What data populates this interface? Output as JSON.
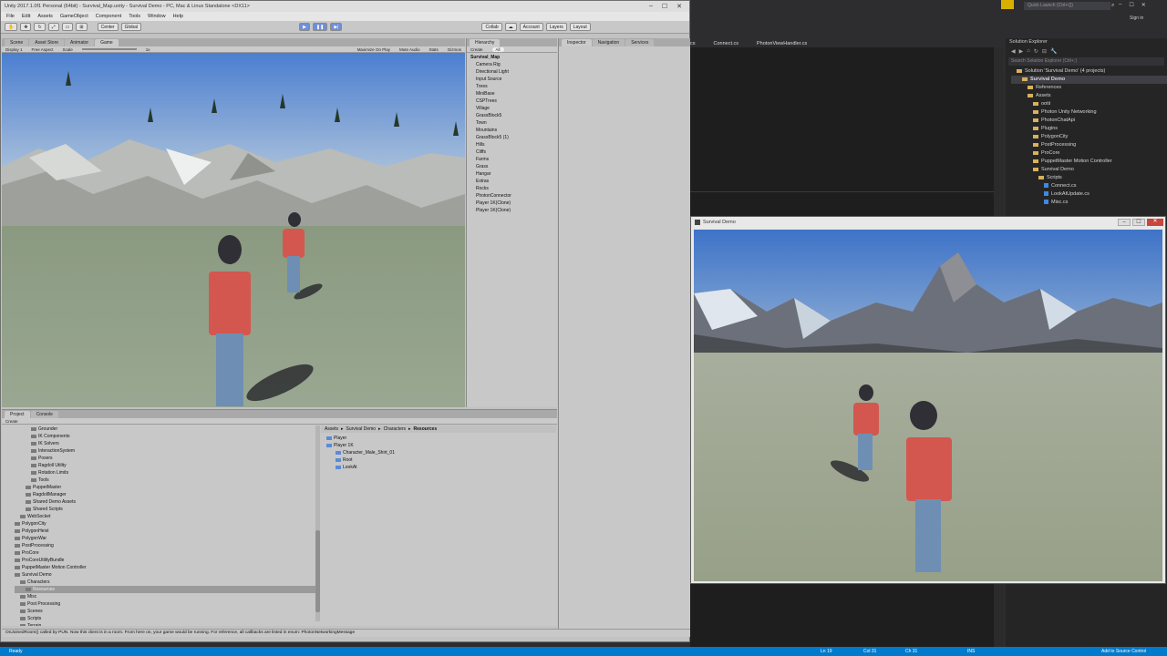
{
  "unity": {
    "title": "Unity 2017.1.0f1 Personal (64bit) - Survival_Map.unity - Survival Demo - PC, Mac & Linux Standalone <DX11>",
    "menu": [
      "File",
      "Edit",
      "Assets",
      "GameObject",
      "Component",
      "Tools",
      "Window",
      "Help"
    ],
    "toolbar": {
      "center": "Center",
      "global": "Global",
      "collab": "Collab",
      "account": "Account",
      "layers": "Layers",
      "layout": "Layout"
    },
    "game_tabs": [
      "Scene",
      "Asset Store",
      "Animator",
      "Game"
    ],
    "game_bar": {
      "display": "Display 1",
      "aspect": "Free Aspect",
      "scale_label": "Scale",
      "scale_value": "1x",
      "options": [
        "Maximize On Play",
        "Mute Audio",
        "Stats",
        "Gizmos"
      ]
    },
    "hierarchy": {
      "tab": "Hierarchy",
      "create": "Create",
      "search_placeholder": "All",
      "scene": "Survival_Map",
      "items": [
        "Camera Rig",
        "Directional Light",
        "Input Source",
        "Trees",
        "MiniBase",
        "CSPTrees",
        "Village",
        "GrassBlock5",
        "Town",
        "Mountains",
        "GrassBlock5 (1)",
        "Hills",
        "Cliffs",
        "Farms",
        "Grass",
        "Hangar",
        "Extras",
        "Rocks",
        "PhotonConnector",
        "Player 1K(Clone)",
        "Player 1K(Clone)"
      ]
    },
    "inspector_tabs": [
      "Inspector",
      "Navigation",
      "Services"
    ],
    "project": {
      "tabs": [
        "Project",
        "Console"
      ],
      "create": "Create",
      "tree": [
        "Grounder",
        "IK Components",
        "IK Solvers",
        "InteractionSystem",
        "Posers",
        "Ragdoll Utility",
        "Rotation Limits",
        "Tools",
        "PuppetMaster",
        "RagdollManager",
        "Shared Demo Assets",
        "Shared Scripts",
        "WebSocket",
        "PolygonCity",
        "PolygonHeist",
        "PolygonWar",
        "PostProcessing",
        "ProCore",
        "ProCoreUtilityBundle",
        "PuppetMaster Motion Controller",
        "Survival Demo",
        "Characters",
        "Resources",
        "Misc",
        "Post Processing",
        "Scenes",
        "Scripts",
        "Terrain"
      ],
      "breadcrumb": [
        "Assets",
        "Survival Demo",
        "Characters",
        "Resources"
      ],
      "files": [
        "Player",
        "Player 1K",
        "Character_Male_Shirt_01",
        "Root",
        "LookAt"
      ]
    },
    "console_message": "OnJoinedRoom() called by PUN. Now this client is in a room. From here on, your game would be running. For reference, all callbacks are listed in enum: PhotonNetworkingMessage"
  },
  "vs": {
    "quick_launch_placeholder": "Quick Launch (Ctrl+Q)",
    "sign_in": "Sign in",
    "tabs": [
      "cs",
      "Connect.cs",
      "PhotonViewHandler.cs"
    ],
    "solution_explorer": {
      "title": "Solution Explorer",
      "search_placeholder": "Search Solution Explorer (Ctrl+;)",
      "items": [
        "Solution 'Survival Demo' (4 projects)",
        "Survival Demo",
        "References",
        "Assets",
        "ootii",
        "Photon Unity Networking",
        "PhotonChatApi",
        "Plugins",
        "PolygonCity",
        "PostProcessing",
        "ProCore",
        "PuppetMaster Motion Controller",
        "Survival Demo",
        "Scripts",
        "Connect.cs",
        "LookAtUpdate.cs",
        "Misc.cs"
      ]
    }
  },
  "game_window": {
    "title": "Survival Demo"
  },
  "status": {
    "ready": "Ready",
    "line": "Ln 19",
    "col": "Col 31",
    "ch": "Ch 31",
    "mode": "INS",
    "source_control": "Add to Source Control"
  },
  "colors": {
    "vs_blue": "#007acc",
    "sky": "#4b7fd0",
    "ground": "#8a9a80",
    "shirt": "#d3574f"
  }
}
